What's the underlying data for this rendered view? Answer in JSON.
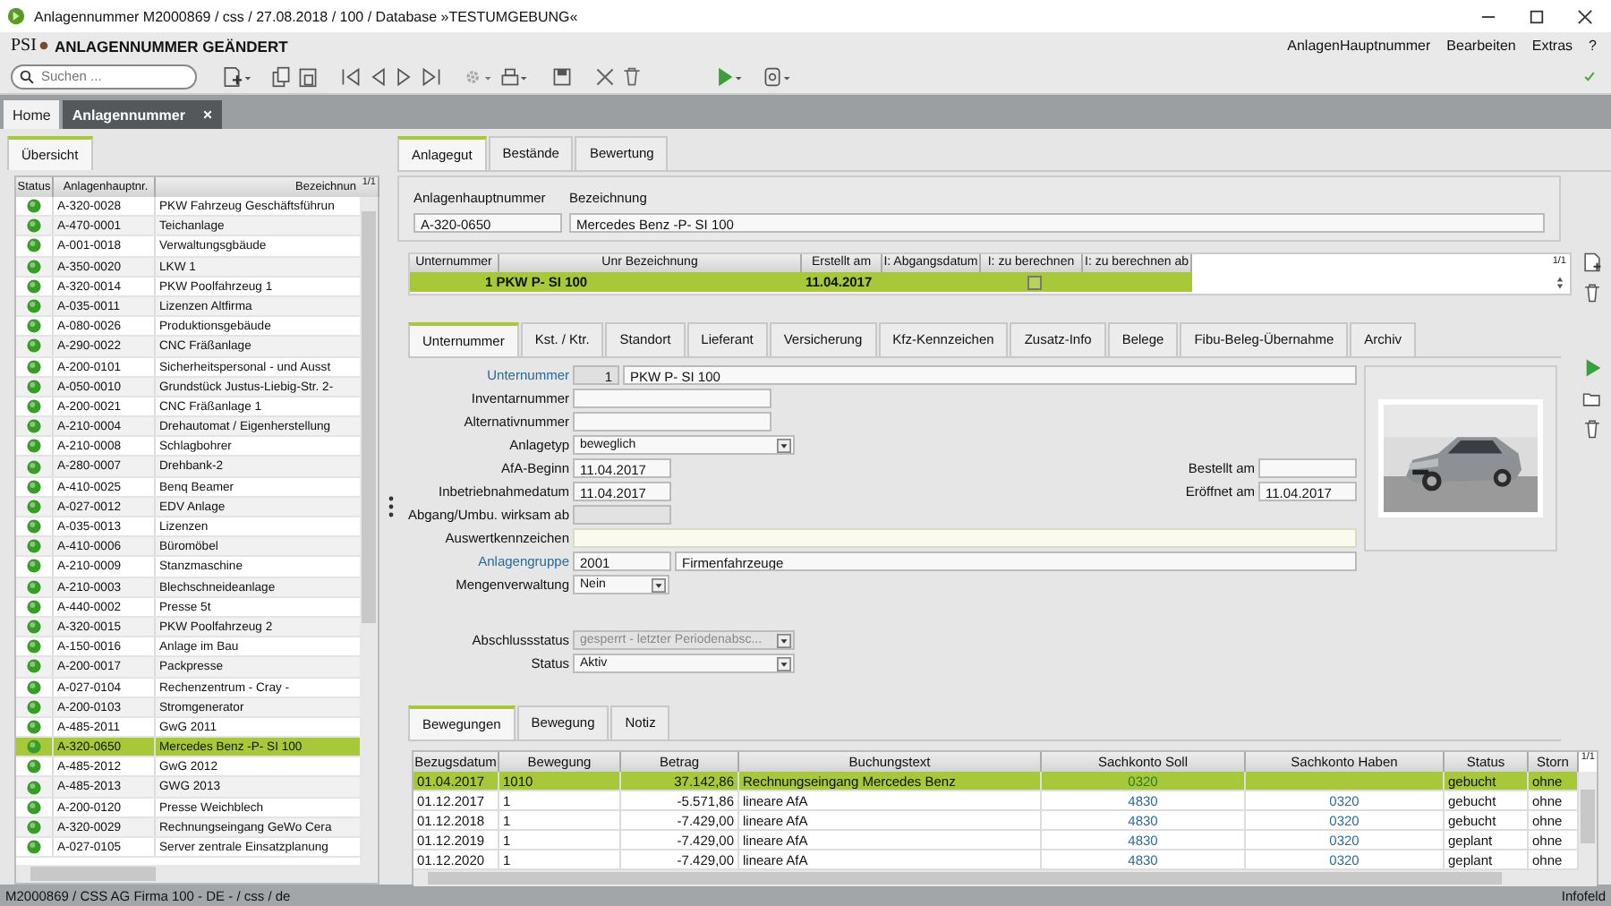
{
  "window": {
    "title": "Anlagennummer M2000869 / css / 27.08.2018 / 100 / Database »TESTUMGEBUNG«"
  },
  "header": {
    "logo": "PSI",
    "title": "ANLAGENNUMMER GEÄNDERT",
    "menu": [
      "AnlagenHauptnummer",
      "Bearbeiten",
      "Extras",
      "?"
    ]
  },
  "toolbar": {
    "search": {
      "placeholder": "Suchen ..."
    }
  },
  "tabs": [
    {
      "label": "Home",
      "selected": false
    },
    {
      "label": "Anlagennummer",
      "selected": true,
      "closable": true
    }
  ],
  "overview": {
    "tab": "Übersicht",
    "page": "1/1",
    "columns": [
      "Status",
      "Anlagenhauptnr.",
      "Bezeichnun"
    ],
    "rows": [
      {
        "number": "A-320-0028",
        "name": "PKW Fahrzeug Geschäftsführun",
        "selected": false
      },
      {
        "number": "A-470-0001",
        "name": "Teichanlage",
        "selected": false
      },
      {
        "number": "A-001-0018",
        "name": "Verwaltungsgbäude",
        "selected": false
      },
      {
        "number": "A-350-0020",
        "name": "LKW 1",
        "selected": false
      },
      {
        "number": "A-320-0014",
        "name": "PKW Poolfahrzeug 1",
        "selected": false
      },
      {
        "number": "A-035-0011",
        "name": "Lizenzen Altfirma",
        "selected": false
      },
      {
        "number": "A-080-0026",
        "name": "Produktionsgebäude",
        "selected": false
      },
      {
        "number": "A-290-0022",
        "name": "CNC Fräßanlage",
        "selected": false
      },
      {
        "number": "A-200-0101",
        "name": "Sicherheitspersonal - und Ausst",
        "selected": false
      },
      {
        "number": "A-050-0010",
        "name": "Grundstück Justus-Liebig-Str. 2-",
        "selected": false
      },
      {
        "number": "A-200-0021",
        "name": "CNC Fräßanlage 1",
        "selected": false
      },
      {
        "number": "A-210-0004",
        "name": "Drehautomat / Eigenherstellung",
        "selected": false
      },
      {
        "number": "A-210-0008",
        "name": "Schlagbohrer",
        "selected": false
      },
      {
        "number": "A-280-0007",
        "name": "Drehbank-2",
        "selected": false
      },
      {
        "number": "A-410-0025",
        "name": "Benq Beamer",
        "selected": false
      },
      {
        "number": "A-027-0012",
        "name": "EDV Anlage",
        "selected": false
      },
      {
        "number": "A-035-0013",
        "name": "Lizenzen",
        "selected": false
      },
      {
        "number": "A-410-0006",
        "name": "Büromöbel",
        "selected": false
      },
      {
        "number": "A-210-0009",
        "name": "Stanzmaschine",
        "selected": false
      },
      {
        "number": "A-210-0003",
        "name": "Blechschneideanlage",
        "selected": false
      },
      {
        "number": "A-440-0002",
        "name": "Presse 5t",
        "selected": false
      },
      {
        "number": "A-320-0015",
        "name": "PKW Poolfahrzeug 2",
        "selected": false
      },
      {
        "number": "A-150-0016",
        "name": "Anlage im Bau",
        "selected": false
      },
      {
        "number": "A-200-0017",
        "name": "Packpresse",
        "selected": false
      },
      {
        "number": "A-027-0104",
        "name": "Rechenzentrum - Cray -",
        "selected": false
      },
      {
        "number": "A-200-0103",
        "name": "Stromgenerator",
        "selected": false
      },
      {
        "number": "A-485-2011",
        "name": "GwG 2011",
        "selected": false
      },
      {
        "number": "A-320-0650",
        "name": "Mercedes Benz -P- SI 100",
        "selected": true
      },
      {
        "number": "A-485-2012",
        "name": "GwG 2012",
        "selected": false
      },
      {
        "number": "A-485-2013",
        "name": "GWG 2013",
        "selected": false
      },
      {
        "number": "A-200-0120",
        "name": "Presse Weichblech",
        "selected": false
      },
      {
        "number": "A-320-0029",
        "name": "Rechnungseingang GeWo Cera",
        "selected": false
      },
      {
        "number": "A-027-0105",
        "name": "Server zentrale Einsatzplanung",
        "selected": false
      }
    ]
  },
  "main_tabs": [
    {
      "label": "Anlagegut",
      "selected": true
    },
    {
      "label": "Bestände",
      "selected": false
    },
    {
      "label": "Bewertung",
      "selected": false
    }
  ],
  "asset": {
    "fields": [
      {
        "label": "Anlagenhauptnummer",
        "value": "A-320-0650"
      },
      {
        "label": "Bezeichnung",
        "value": "Mercedes Benz -P- SI 100"
      }
    ]
  },
  "subnumbers": {
    "page": "1/1",
    "columns": [
      "Unternummer",
      "Unr Bezeichnung",
      "Erstellt am",
      "I: Abgangsdatum",
      "I: zu berechnen",
      "I: zu berechnen ab"
    ],
    "rows": [
      {
        "number_name": "1 PKW P- SI 100",
        "created": "11.04.2017",
        "disposal": "",
        "calculate": false,
        "calculate_from": "",
        "selected": true
      }
    ]
  },
  "detail_tabs": [
    {
      "label": "Unternummer",
      "selected": true
    },
    {
      "label": "Kst. / Ktr.",
      "selected": false
    },
    {
      "label": "Standort",
      "selected": false
    },
    {
      "label": "Lieferant",
      "selected": false
    },
    {
      "label": "Versicherung",
      "selected": false
    },
    {
      "label": "Kfz-Kennzeichen",
      "selected": false
    },
    {
      "label": "Zusatz-Info",
      "selected": false
    },
    {
      "label": "Belege",
      "selected": false
    },
    {
      "label": "Fibu-Beleg-Übernahme",
      "selected": false
    },
    {
      "label": "Archiv",
      "selected": false
    }
  ],
  "form": {
    "rows": [
      {
        "kind": "pair",
        "label": "Unternummer",
        "link": true,
        "code": "1",
        "value": "PKW P- SI 100"
      },
      {
        "kind": "text",
        "label": "Inventarnummer",
        "link": false,
        "disabled": false
      },
      {
        "kind": "text",
        "label": "Alternativnummer",
        "link": false,
        "disabled": false
      },
      {
        "kind": "dropdown",
        "label": "Anlagetyp",
        "link": false,
        "value": "beweglich",
        "disabled": false
      },
      {
        "kind": "date",
        "label": "AfA-Beginn",
        "link": false,
        "value": "11.04.2017",
        "disabled": false,
        "side": {
          "label": "Bestellt am"
        }
      },
      {
        "kind": "date",
        "label": "Inbetriebnahmedatum",
        "link": false,
        "value": "11.04.2017",
        "disabled": false,
        "side": {
          "label": "Eröffnet am",
          "value": "11.04.2017"
        }
      },
      {
        "kind": "date",
        "label": "Abgang/Umbu. wirksam ab",
        "link": false,
        "disabled": true
      },
      {
        "kind": "wide",
        "label": "Auswertkennzeichen",
        "link": false
      },
      {
        "kind": "pair_code",
        "label": "Anlagengruppe",
        "link": true,
        "code": "2001",
        "value": "Firmenfahrzeuge"
      },
      {
        "kind": "short_dropdown",
        "label": "Mengenverwaltung",
        "link": false,
        "value": "Nein",
        "disabled": false
      }
    ],
    "closing_rows": [
      {
        "kind": "dropdown",
        "label": "Abschlussstatus",
        "link": false,
        "value": "gesperrt - letzter Periodenabsc...",
        "disabled": true
      },
      {
        "kind": "dropdown",
        "label": "Status",
        "link": false,
        "value": "Aktiv",
        "disabled": false
      }
    ]
  },
  "movement_tabs": [
    {
      "label": "Bewegungen",
      "selected": true
    },
    {
      "label": "Bewegung",
      "selected": false
    },
    {
      "label": "Notiz",
      "selected": false
    }
  ],
  "movements": {
    "page": "1/1",
    "columns": [
      "Bezugsdatum",
      "Bewegung",
      "Betrag",
      "Buchungstext",
      "Sachkonto Soll",
      "Sachkonto Haben",
      "Status",
      "Storn"
    ],
    "rows": [
      {
        "cells": [
          "01.04.2017",
          "1010",
          "37.142,86",
          "Rechnungseingang Mercedes Benz",
          "0320",
          "",
          "gebucht",
          "ohne"
        ],
        "selected": true
      },
      {
        "cells": [
          "01.12.2017",
          "1",
          "-5.571,86",
          "lineare AfA",
          "4830",
          "0320",
          "gebucht",
          "ohne"
        ],
        "selected": false
      },
      {
        "cells": [
          "01.12.2018",
          "1",
          "-7.429,00",
          "lineare AfA",
          "4830",
          "0320",
          "gebucht",
          "ohne"
        ],
        "selected": false
      },
      {
        "cells": [
          "01.12.2019",
          "1",
          "-7.429,00",
          "lineare AfA",
          "4830",
          "0320",
          "geplant",
          "ohne"
        ],
        "selected": false
      },
      {
        "cells": [
          "01.12.2020",
          "1",
          "-7.429,00",
          "lineare AfA",
          "4830",
          "0320",
          "geplant",
          "ohne"
        ],
        "selected": false
      }
    ]
  },
  "status_bar": {
    "left": "M2000869 / CSS AG Firma 100 - DE - / css / de",
    "right": "Infofeld"
  }
}
